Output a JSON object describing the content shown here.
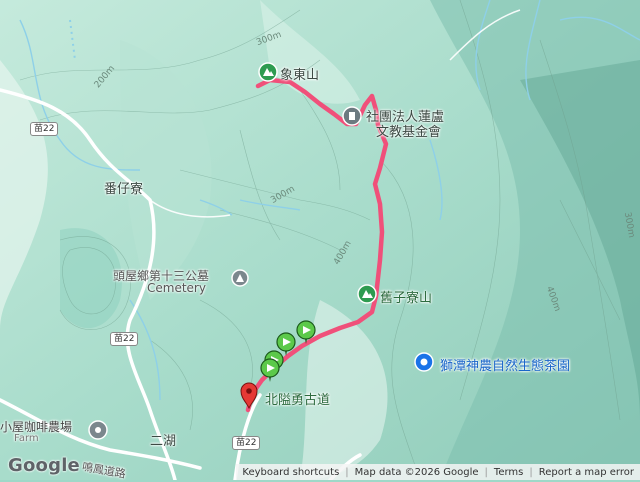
{
  "places": {
    "peak_lianmen": "象東山",
    "foundation_line1": "社團法人蓮盧",
    "foundation_line2": "文教基金會",
    "fanzai_liao": "番仔寮",
    "cemetery": "頭屋鄉第十三公墓",
    "cemetery_en": "Cemetery",
    "jiu_zi_liao_shan": "舊子寮山",
    "tea_garden": "獅潭神農自然生態茶園",
    "beilong_trail": "北隘勇古道",
    "cabin_farm": "小屋咖啡農場",
    "cabin_farm_en": "Farm",
    "er_hu": "二湖",
    "ming_feng_road": "鳴鳳道路"
  },
  "road_shields": [
    "苗22",
    "苗22",
    "苗22"
  ],
  "contours": [
    "300m",
    "200m",
    "300m",
    "400m",
    "400m",
    "300m"
  ],
  "footer": {
    "shortcuts": "Keyboard shortcuts",
    "map_data": "Map data ©2026 Google",
    "terms": "Terms",
    "report": "Report a map error"
  },
  "logo": "Google",
  "icons": {
    "peak": "peak-marker-icon",
    "poi": "poi-marker-icon",
    "cemetery": "cemetery-icon",
    "attraction": "attraction-marker-icon",
    "farm": "farm-marker-icon",
    "start": "red-pin-icon",
    "waypoint": "green-flag-icon"
  },
  "colors": {
    "track": "#f0507a",
    "terrain_light": "#bfe8da",
    "terrain_mid": "#9fd8c8",
    "terrain_dark": "#7cc1b0",
    "road": "#ffffff",
    "water": "#8ed0e8"
  }
}
